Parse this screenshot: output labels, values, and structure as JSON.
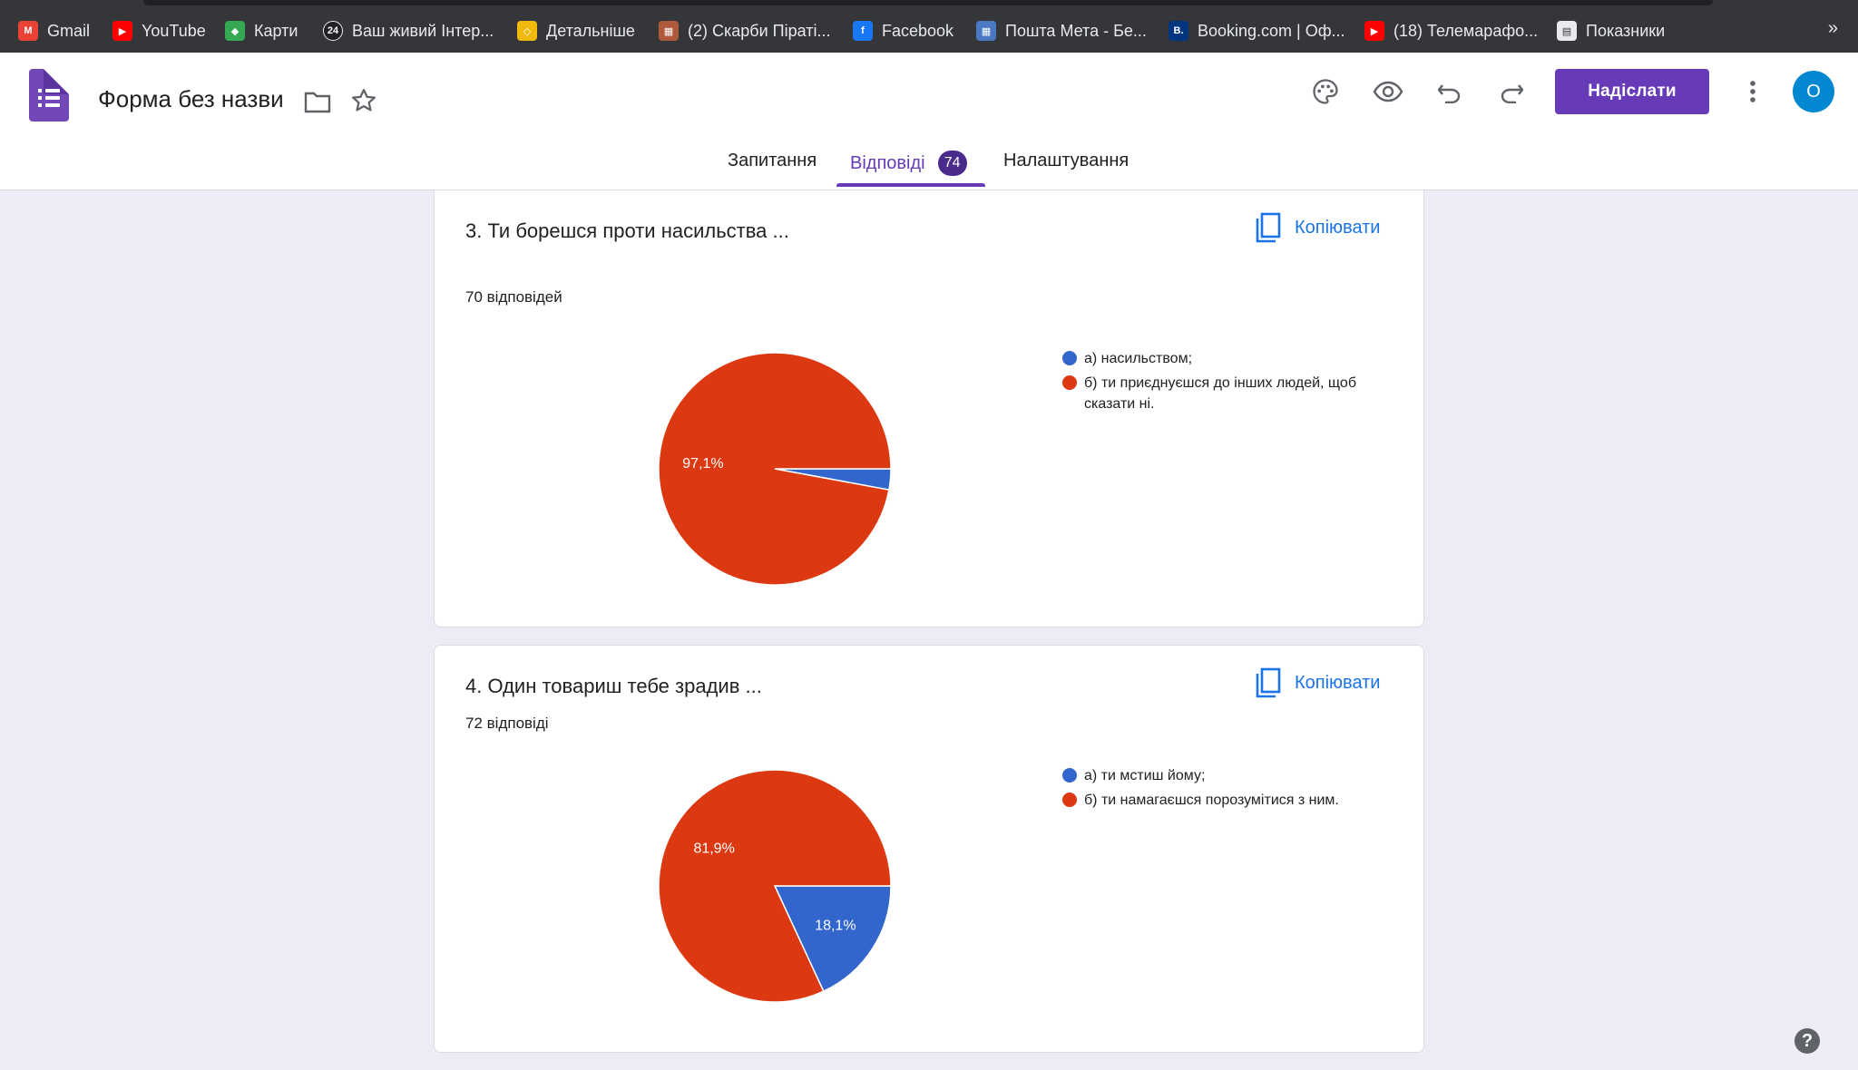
{
  "bookmarks": [
    {
      "label": "Gmail",
      "icon": "gmail-icon",
      "color": "#ea4335",
      "glyph": "M"
    },
    {
      "label": "YouTube",
      "icon": "youtube-icon",
      "color": "#ff0000",
      "glyph": "▶"
    },
    {
      "label": "Карти",
      "icon": "maps-icon",
      "color": "#34a853",
      "glyph": "◆"
    },
    {
      "label": "Ваш живий Інтер...",
      "icon": "channel24-icon",
      "color": "#202124",
      "glyph": "24"
    },
    {
      "label": "Детальніше",
      "icon": "binance-icon",
      "color": "#f0b90b",
      "glyph": "◇"
    },
    {
      "label": "(2) Скарби Піраті...",
      "icon": "pirates-icon",
      "color": "#b05a3c",
      "glyph": "▦"
    },
    {
      "label": "Facebook",
      "icon": "facebook-icon",
      "color": "#1877f2",
      "glyph": "f"
    },
    {
      "label": "Пошта Мета - Бе...",
      "icon": "meta-mail-icon",
      "color": "#4a78c2",
      "glyph": "▦"
    },
    {
      "label": "Booking.com | Оф...",
      "icon": "booking-icon",
      "color": "#003580",
      "glyph": "B."
    },
    {
      "label": "(18) Телемарафо...",
      "icon": "youtube-icon",
      "color": "#ff0000",
      "glyph": "▶"
    },
    {
      "label": "Показники",
      "icon": "document-icon",
      "color": "#e8eaed",
      "glyph": "▤"
    }
  ],
  "bookmarks_more": "»",
  "header": {
    "title": "Форма без назви",
    "send_label": "Надіслати",
    "avatar_letter": "О"
  },
  "tabs": [
    {
      "label": "Запитання"
    },
    {
      "label": "Відповіді",
      "badge": "74"
    },
    {
      "label": "Налаштування"
    }
  ],
  "copy_label": "Копіювати",
  "colors": {
    "accent": "#673ab7",
    "blue": "#3366cc",
    "red": "#dc3912",
    "link": "#1a73e8"
  },
  "cards": [
    {
      "title": "3. Ти борешся проти насильства ...",
      "count": "70 відповідей",
      "legend": [
        "а) насильством;",
        "б) ти приєднуєшся до інших людей, щоб сказати ні."
      ]
    },
    {
      "title": "4. Один товариш тебе зрадив ...",
      "count": "72 відповіді",
      "legend": [
        "а) ти мстиш йому;",
        "б) ти намагаєшся порозумітися з ним."
      ]
    }
  ],
  "chart_data": [
    {
      "type": "pie",
      "categories": [
        "а) насильством;",
        "б) ти приєднуєшся до інших людей, щоб сказати ні."
      ],
      "values": [
        2.9,
        97.1
      ],
      "labels": [
        "",
        "97,1%"
      ],
      "colors": [
        "#3366cc",
        "#dc3912"
      ],
      "legend": "right"
    },
    {
      "type": "pie",
      "categories": [
        "а) ти мстиш йому;",
        "б) ти намагаєшся порозумітися з ним."
      ],
      "values": [
        18.1,
        81.9
      ],
      "labels": [
        "18,1%",
        "81,9%"
      ],
      "colors": [
        "#3366cc",
        "#dc3912"
      ],
      "legend": "right"
    }
  ],
  "help_glyph": "?"
}
